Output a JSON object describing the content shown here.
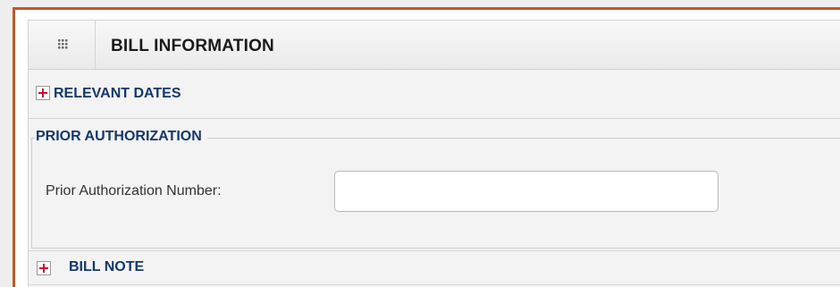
{
  "panel": {
    "title": "BILL INFORMATION",
    "icon": "grid-icon"
  },
  "sections": {
    "relevant_dates": {
      "label": "RELEVANT DATES",
      "icon": "expand-plus-icon"
    },
    "prior_authorization": {
      "label": "PRIOR AUTHORIZATION",
      "field_label": "Prior Authorization Number:",
      "field_value": "",
      "field_placeholder": ""
    },
    "bill_note": {
      "label": "BILL NOTE",
      "icon": "expand-plus-icon"
    }
  },
  "colors": {
    "frame_border": "#c0582c",
    "section_title": "#15376b",
    "plus_icon": "#c8102e"
  }
}
